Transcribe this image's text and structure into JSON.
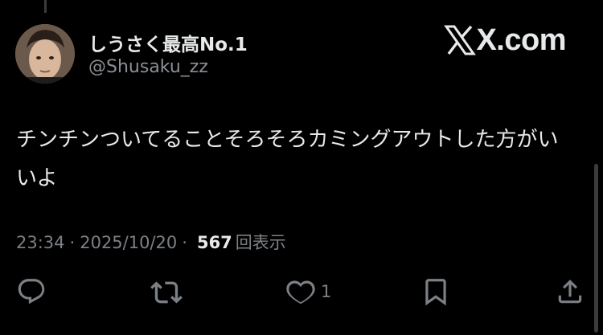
{
  "tweet": {
    "author": {
      "display_name": "しうさく最高No.1",
      "handle": "@Shusaku_zz"
    },
    "brand": "X.com",
    "text": "チンチンついてることそろそろカミングアウトした方がいいよ",
    "time": "23:34",
    "date": "2025/10/20",
    "separator": "·",
    "views_count": "567",
    "views_label": "回表示",
    "like_count": "1"
  },
  "icons": {
    "reply": "reply-icon",
    "retweet": "retweet-icon",
    "like": "heart-icon",
    "bookmark": "bookmark-icon",
    "share": "share-icon"
  },
  "colors": {
    "background": "#000000",
    "text_primary": "#e7e9ea",
    "text_secondary": "#7c8085"
  }
}
